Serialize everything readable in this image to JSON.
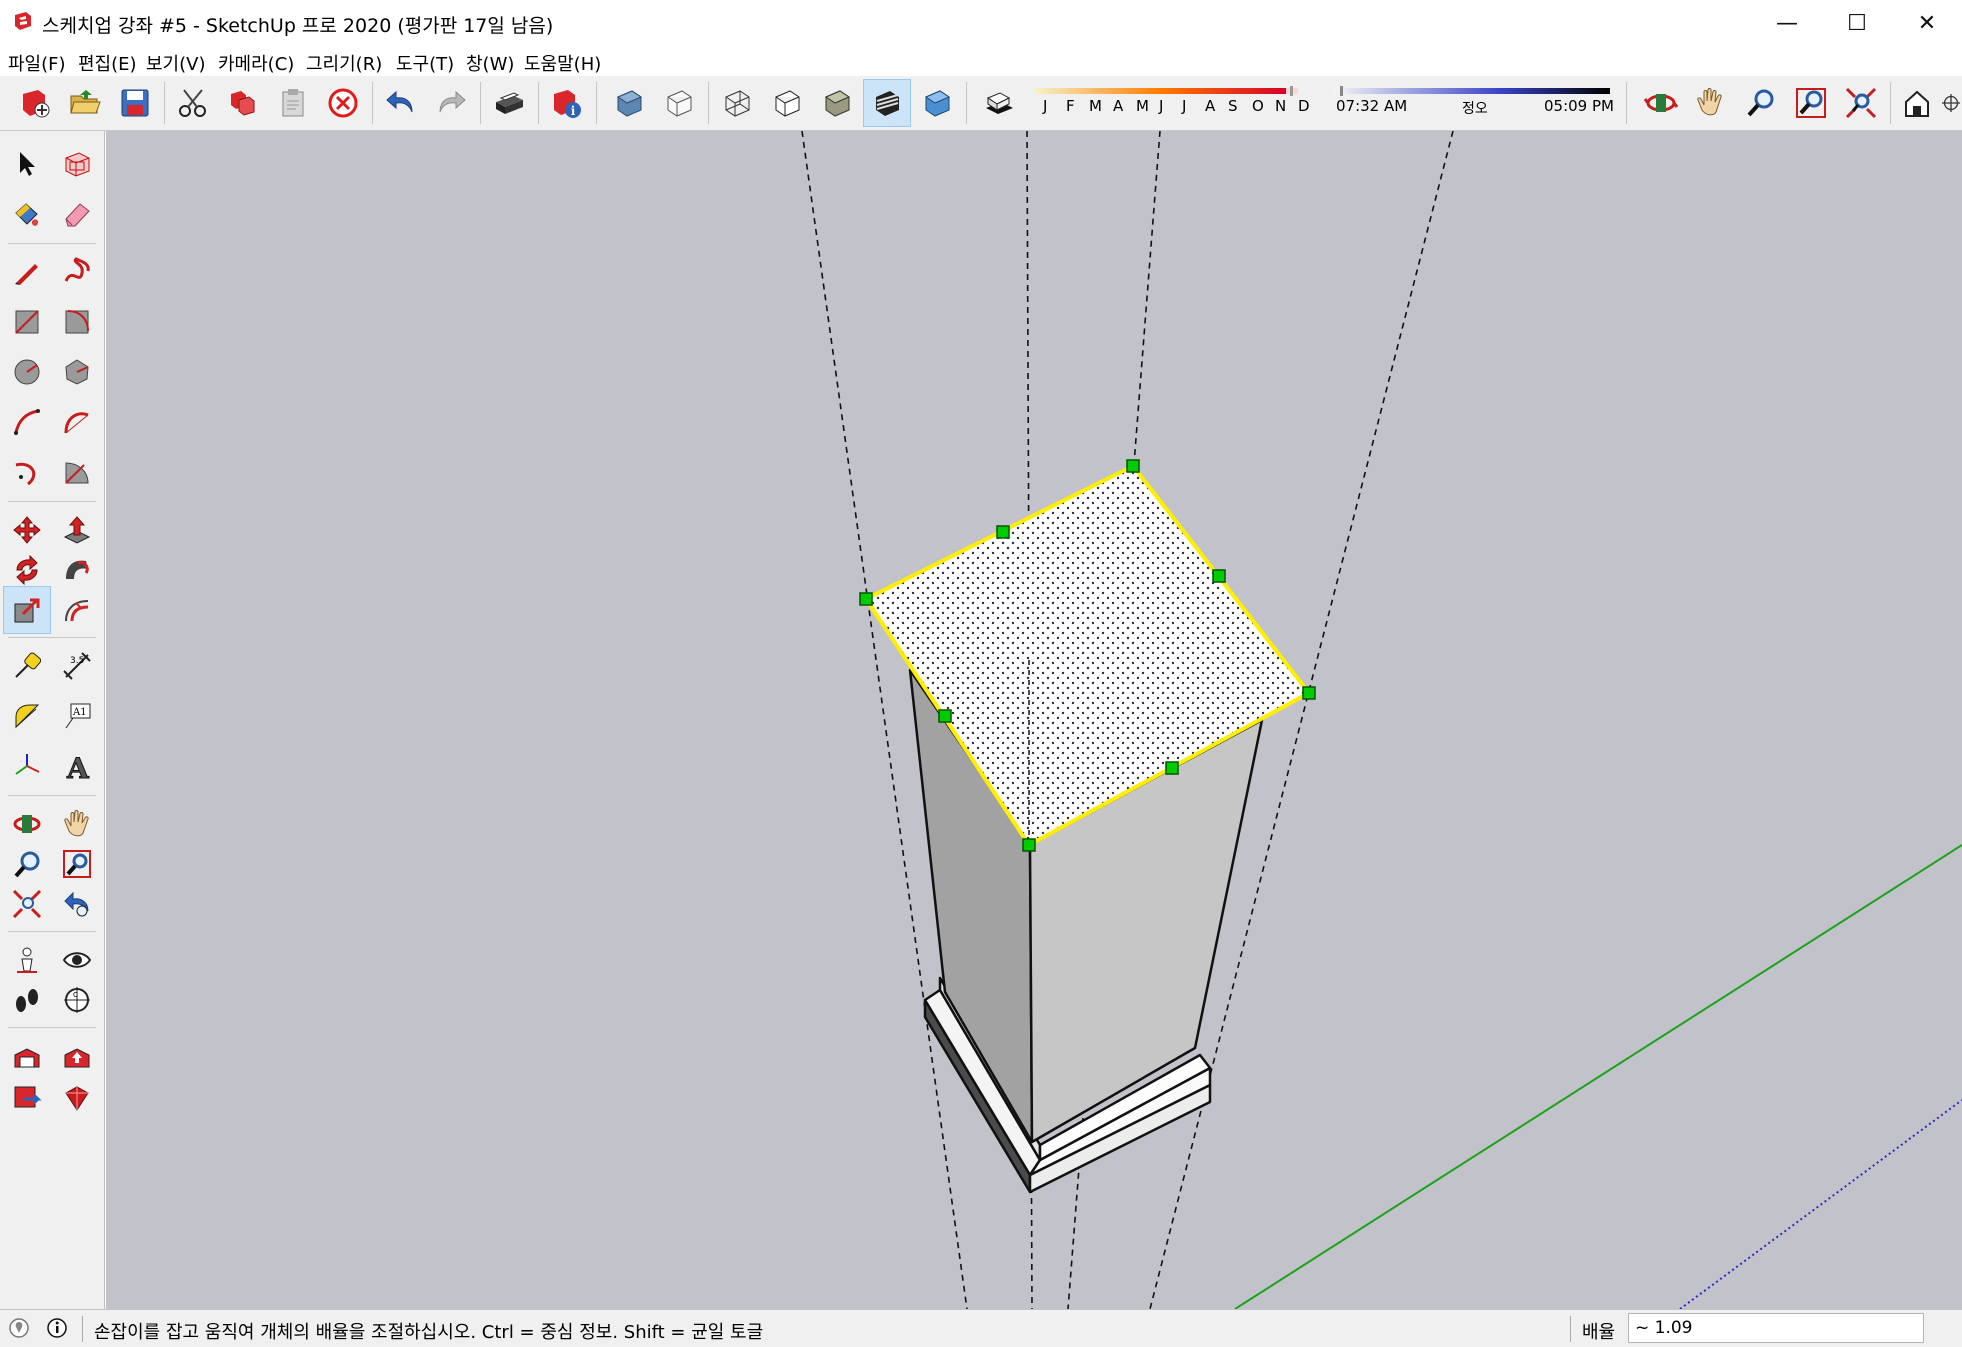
{
  "window": {
    "title": "스케치업 강좌 #5 - SketchUp 프로 2020 (평가판 17일 남음)",
    "minimize": "—",
    "maximize": "☐",
    "close": "✕"
  },
  "menu": [
    {
      "label": "파일(F)"
    },
    {
      "label": "편집(E)"
    },
    {
      "label": "보기(V)"
    },
    {
      "label": "카메라(C)"
    },
    {
      "label": "그리기(R)"
    },
    {
      "label": "도구(T)"
    },
    {
      "label": "창(W)"
    },
    {
      "label": "도움말(H)"
    }
  ],
  "shadow": {
    "months": [
      "J",
      "F",
      "M",
      "A",
      "M",
      "J",
      "J",
      "A",
      "S",
      "O",
      "N",
      "D"
    ],
    "time_start": "07:32 AM",
    "time_noon": "정오",
    "time_end": "05:09 PM"
  },
  "status": {
    "message": "손잡이를 잡고 움직여 개체의 배율을 조절하십시오. Ctrl = 중심 정보. Shift = 균일 토글",
    "vcb_label": "배율",
    "vcb_value": "~ 1.09"
  },
  "colors": {
    "viewport_bg": "#c2c3ca",
    "selection": "#ffee00",
    "grip": "#00cc00",
    "green_axis": "#1aa31a",
    "blue_axis": "#2020c0"
  }
}
